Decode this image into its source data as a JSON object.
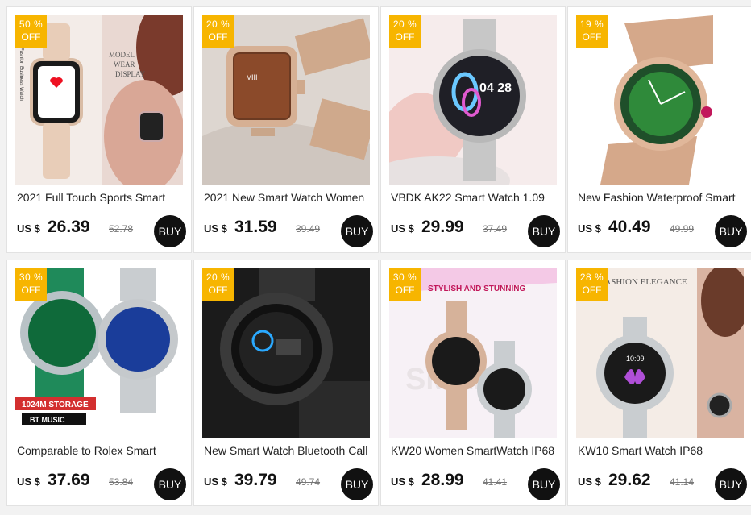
{
  "products": [
    {
      "discount": "50 %",
      "off": "OFF",
      "title": "2021 Full Touch Sports Smart",
      "currency": "US $",
      "price": "26.39",
      "old_price": "52.78",
      "buy": "BUY",
      "img_caption_1": "MODEL",
      "img_caption_2": "WEAR",
      "img_caption_3": "DISPLAY",
      "img_side": "Fashion Business Watch"
    },
    {
      "discount": "20 %",
      "off": "OFF",
      "title": "2021 New Smart Watch Women",
      "currency": "US $",
      "price": "31.59",
      "old_price": "39.49",
      "buy": "BUY"
    },
    {
      "discount": "20 %",
      "off": "OFF",
      "title": "VBDK AK22 Smart Watch 1.09",
      "currency": "US $",
      "price": "29.99",
      "old_price": "37.49",
      "buy": "BUY",
      "img_time": "04 28"
    },
    {
      "discount": "19 %",
      "off": "OFF",
      "title": "New Fashion Waterproof Smart",
      "currency": "US $",
      "price": "40.49",
      "old_price": "49.99",
      "buy": "BUY"
    },
    {
      "discount": "30 %",
      "off": "OFF",
      "title": "Comparable to Rolex Smart",
      "currency": "US $",
      "price": "37.69",
      "old_price": "53.84",
      "buy": "BUY",
      "img_tag_1": "1024M STORAGE",
      "img_tag_2": "BT MUSIC"
    },
    {
      "discount": "20 %",
      "off": "OFF",
      "title": "New Smart Watch Bluetooth Call",
      "currency": "US $",
      "price": "39.79",
      "old_price": "49.74",
      "buy": "BUY"
    },
    {
      "discount": "30 %",
      "off": "OFF",
      "title": "KW20 Women SmartWatch IP68",
      "currency": "US $",
      "price": "28.99",
      "old_price": "41.41",
      "buy": "BUY",
      "img_head": "STYLISH AND STUNNING",
      "img_big": "SMART"
    },
    {
      "discount": "28 %",
      "off": "OFF",
      "title": "KW10 Smart Watch IP68",
      "currency": "US $",
      "price": "29.62",
      "old_price": "41.14",
      "buy": "BUY",
      "img_head": "FASHION ELEGANCE",
      "img_time": "10:09"
    }
  ],
  "colors": {
    "badge": "#f7b500",
    "buy_bg": "#111111",
    "page_bg": "#f2f2f2"
  }
}
